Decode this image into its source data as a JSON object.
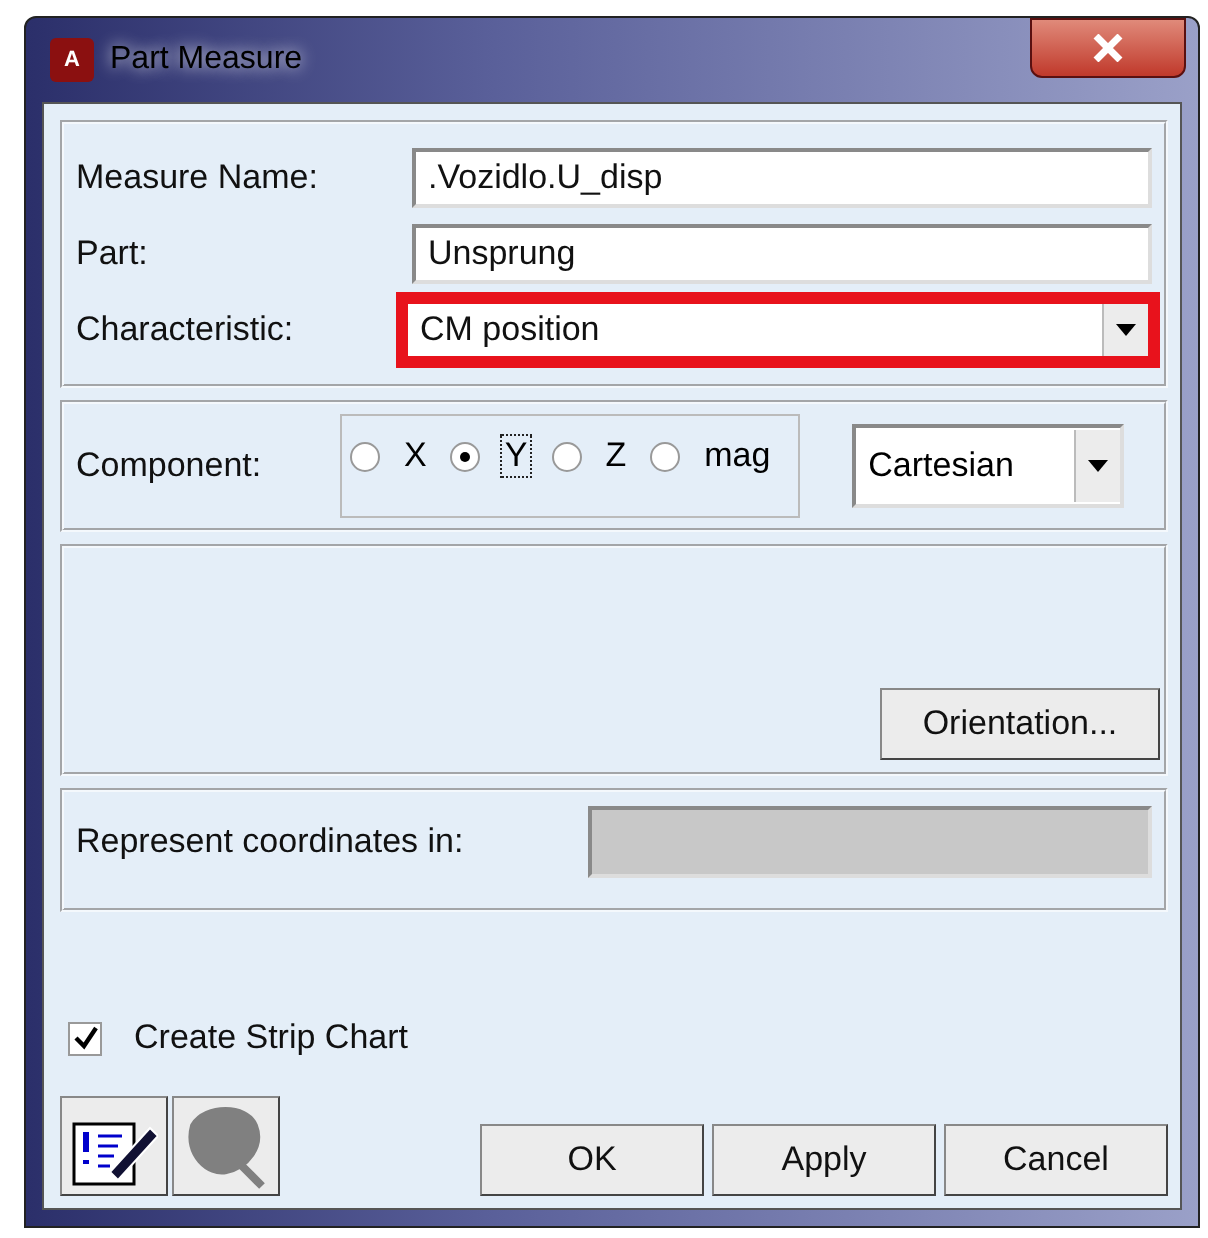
{
  "window": {
    "title": "Part Measure",
    "icon_letter": "A"
  },
  "fields": [
    {
      "label": "Measure Name:",
      "value": ".Vozidlo.U_disp",
      "kind": "text",
      "highlighted": false
    },
    {
      "label": "Part:",
      "value": "Unsprung",
      "kind": "text",
      "highlighted": false
    },
    {
      "label": "Characteristic:",
      "value": "CM position",
      "kind": "dropdown",
      "highlighted": true
    }
  ],
  "component": {
    "label": "Component:",
    "options": [
      {
        "label": "X",
        "selected": false
      },
      {
        "label": "Y",
        "selected": true
      },
      {
        "label": "Z",
        "selected": false
      },
      {
        "label": "mag",
        "selected": false
      }
    ],
    "system": "Cartesian"
  },
  "orientation_button": "Orientation...",
  "represent": {
    "label": "Represent coordinates in:",
    "disabled": true
  },
  "strip_chart": {
    "label": "Create Strip Chart",
    "checked": true
  },
  "buttons": [
    "OK",
    "Apply",
    "Cancel"
  ]
}
